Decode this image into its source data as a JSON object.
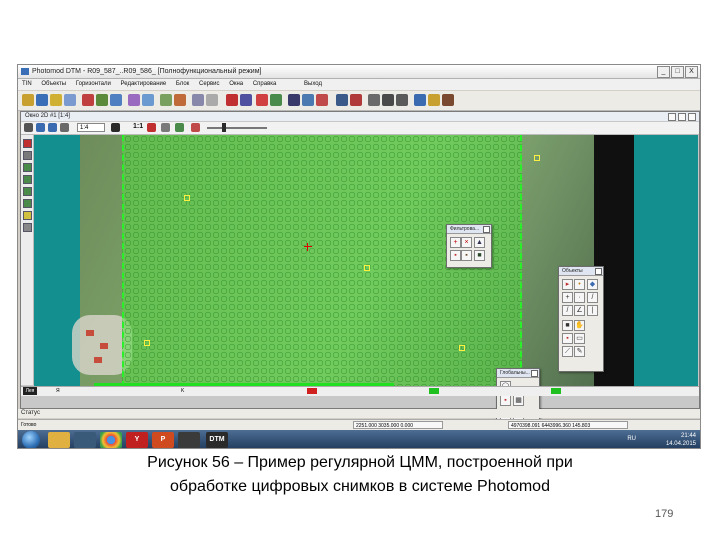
{
  "app": {
    "title": "Photomod DTM - R09_587_..R09_586_ [Полнофункциональный режим]",
    "window_controls": [
      "_",
      "□",
      "X"
    ]
  },
  "menu": [
    "TIN",
    "Объекты",
    "Горизонтали",
    "Редактирование",
    "Блок",
    "Сервис",
    "Окна",
    "Справка",
    "Выход"
  ],
  "subwindow": {
    "title": "Окно 2D #1 [1:4]",
    "zoom_value": "1:4",
    "ratio_label": "1:1"
  },
  "panels": {
    "small": {
      "title": "Фильтрова..."
    },
    "objects": {
      "title": "Объекты"
    },
    "global": {
      "title": "Глобальны..."
    }
  },
  "layer_label": "Лея",
  "scroll_labels": [
    "Я",
    "K"
  ],
  "status": {
    "label": "Статус",
    "ready": "Готово",
    "coords_left": "2251.000 3035.000 0.000",
    "coords_right": "4970398.091 6443996.360 145.803"
  },
  "taskbar": {
    "dtm_label": "DTM",
    "lang": "RU",
    "time": "21:44",
    "date": "14.04.2015"
  },
  "caption": {
    "line1": "Рисунок 56 – Пример регулярной ЦММ, построенной при",
    "line2": "обработке цифровых снимков в системе Photomod"
  },
  "page_number": "179",
  "colors": {
    "accent_green": "#2af02a",
    "background_teal": "#128f8e"
  }
}
